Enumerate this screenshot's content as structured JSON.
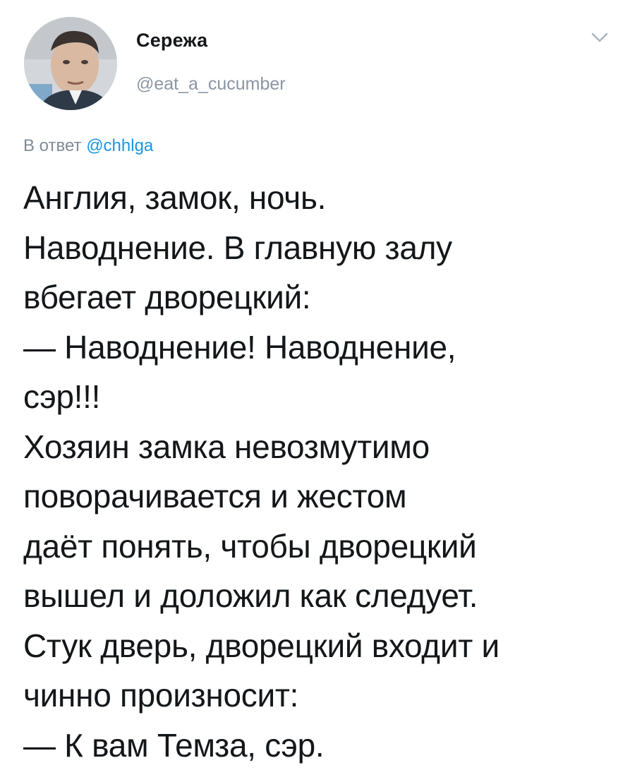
{
  "author": {
    "display_name": "Сережа",
    "handle": "@eat_a_cucumber",
    "avatar_alt": "avatar"
  },
  "menu_icon": "chevron-down-icon",
  "reply": {
    "prefix": "В ответ",
    "mention": "@chhlga"
  },
  "tweet": {
    "lines": [
      "Англия, замок, ночь.",
      "Наводнение. В главную залу",
      "вбегает дворецкий:",
      "— Наводнение! Наводнение,",
      "сэр!!!",
      "Хозяин замка невозмутимо",
      "поворачивается и жестом",
      "даёт понять, чтобы дворецкий",
      "вышел и доложил как следует.",
      "Стук дверь, дворецкий входит и",
      "чинно произносит:",
      "— К вам Темза, сэр."
    ]
  },
  "colors": {
    "text": "#14171a",
    "secondary": "#8a96a3",
    "link": "#1b95e0",
    "background": "#ffffff"
  }
}
